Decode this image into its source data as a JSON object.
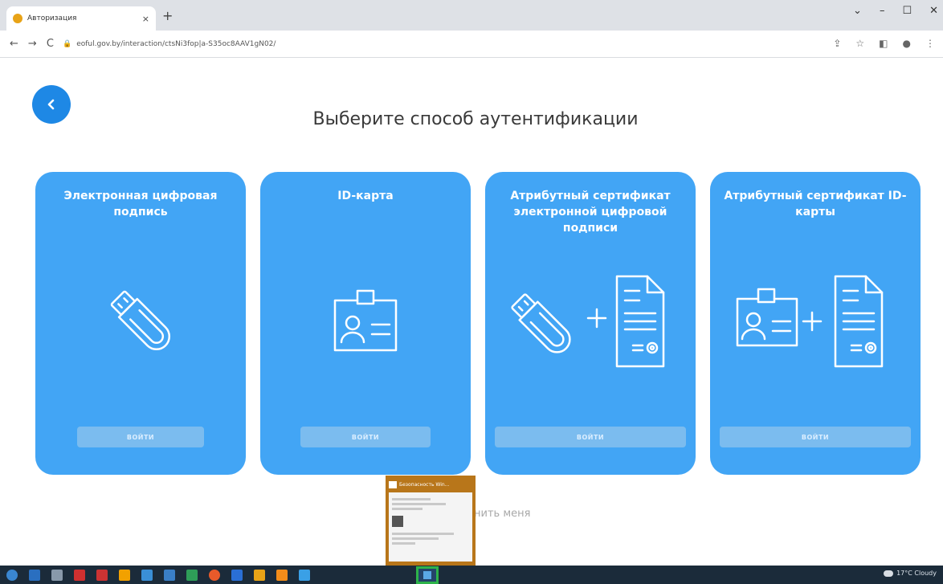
{
  "browser": {
    "tab_title": "Авторизация",
    "tab_close": "×",
    "new_tab": "+",
    "url": "eoful.gov.by/interaction/ctsNi3fop|a-S35oc8AAV1gN02/",
    "nav": {
      "back": "←",
      "forward": "→",
      "reload": "C"
    },
    "window_controls": [
      "⌄",
      "–",
      "☐",
      "✕"
    ],
    "tools": [
      "⇪",
      "☆",
      "◧",
      "●",
      "⋮"
    ]
  },
  "page": {
    "title": "Выберите способ аутентификации",
    "back_icon": "chevron-left-icon",
    "remember_text": "нить меня"
  },
  "cards": [
    {
      "title": "Электронная цифровая подпись",
      "button": "ВОЙТИ",
      "icon": "usb-key-icon"
    },
    {
      "title": "ID-карта",
      "button": "ВОЙТИ",
      "icon": "id-card-icon"
    },
    {
      "title": "Атрибутный сертификат электронной цифровой подписи",
      "button": "ВОЙТИ",
      "icon": "usb-key-plus-certificate-icon"
    },
    {
      "title": "Атрибутный сертификат ID-карты",
      "button": "ВОЙТИ",
      "icon": "id-card-plus-certificate-icon"
    }
  ],
  "popup": {
    "title": "Безопасность Win..."
  },
  "taskbar": {
    "weather": "17°C Cloudy",
    "icon_colors": [
      "#3a86d0",
      "#2a6fc0",
      "#8899aa",
      "#d03030",
      "#cc3333",
      "#f2a100",
      "#3a8fd6",
      "#3a7fc6",
      "#2e9e58",
      "#e85a2a",
      "#2a6fd6",
      "#e8a317",
      "#f28c1a",
      "#3aa0e6"
    ]
  },
  "colors": {
    "card": "#42a5f5",
    "back_button": "#1e88e5",
    "card_button": "#7bbcef",
    "taskbar": "#1b2b3a",
    "active_border": "#2db34a"
  }
}
